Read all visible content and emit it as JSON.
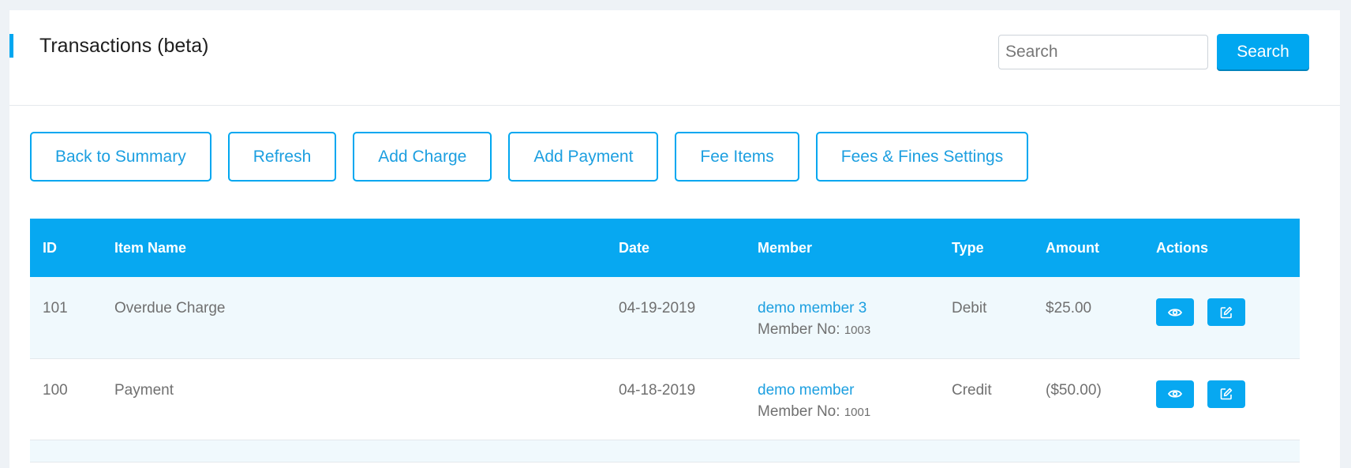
{
  "header": {
    "title": "Transactions (beta)",
    "search_placeholder": "Search",
    "search_value": "",
    "search_button": "Search"
  },
  "toolbar": {
    "buttons": [
      {
        "label": "Back to Summary"
      },
      {
        "label": "Refresh"
      },
      {
        "label": "Add Charge"
      },
      {
        "label": "Add Payment"
      },
      {
        "label": "Fee Items"
      },
      {
        "label": "Fees & Fines Settings"
      }
    ]
  },
  "table": {
    "columns": [
      "ID",
      "Item Name",
      "Date",
      "Member",
      "Type",
      "Amount",
      "Actions"
    ],
    "rows": [
      {
        "id": "101",
        "item_name": "Overdue Charge",
        "date": "04-19-2019",
        "member_name": "demo member 3",
        "member_no_label": "Member No:",
        "member_no": "1003",
        "type": "Debit",
        "amount": "$25.00"
      },
      {
        "id": "100",
        "item_name": "Payment",
        "date": "04-18-2019",
        "member_name": "demo member",
        "member_no_label": "Member No:",
        "member_no": "1001",
        "type": "Credit",
        "amount": "($50.00)"
      }
    ]
  },
  "icons": {
    "view": "eye-icon",
    "edit": "edit-icon"
  },
  "colors": {
    "accent": "#07a8f1",
    "link": "#1c9fe0",
    "row_shade": "#f0f9fd"
  }
}
